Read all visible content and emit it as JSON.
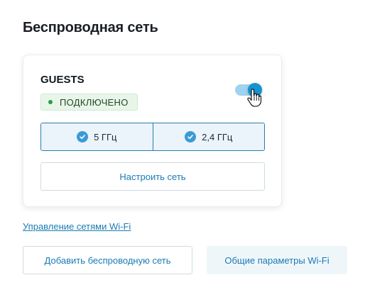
{
  "section": {
    "title": "Беспроводная сеть"
  },
  "network_card": {
    "name": "GUESTS",
    "status": "ПОДКЛЮЧЕНО",
    "toggle_state": "on",
    "bands": [
      {
        "label": "5 ГГц",
        "checked": true
      },
      {
        "label": "2,4 ГГц",
        "checked": true
      }
    ],
    "configure_label": "Настроить сеть"
  },
  "links": {
    "manage_wifi": "Управление сетями Wi-Fi"
  },
  "actions": {
    "add_wireless": "Добавить беспроводную сеть",
    "general_wifi": "Общие параметры Wi-Fi"
  },
  "colors": {
    "accent": "#1592cf",
    "link": "#1a7bb5",
    "status_bg": "#e8f6ea",
    "status_dot": "#2e9a43"
  }
}
